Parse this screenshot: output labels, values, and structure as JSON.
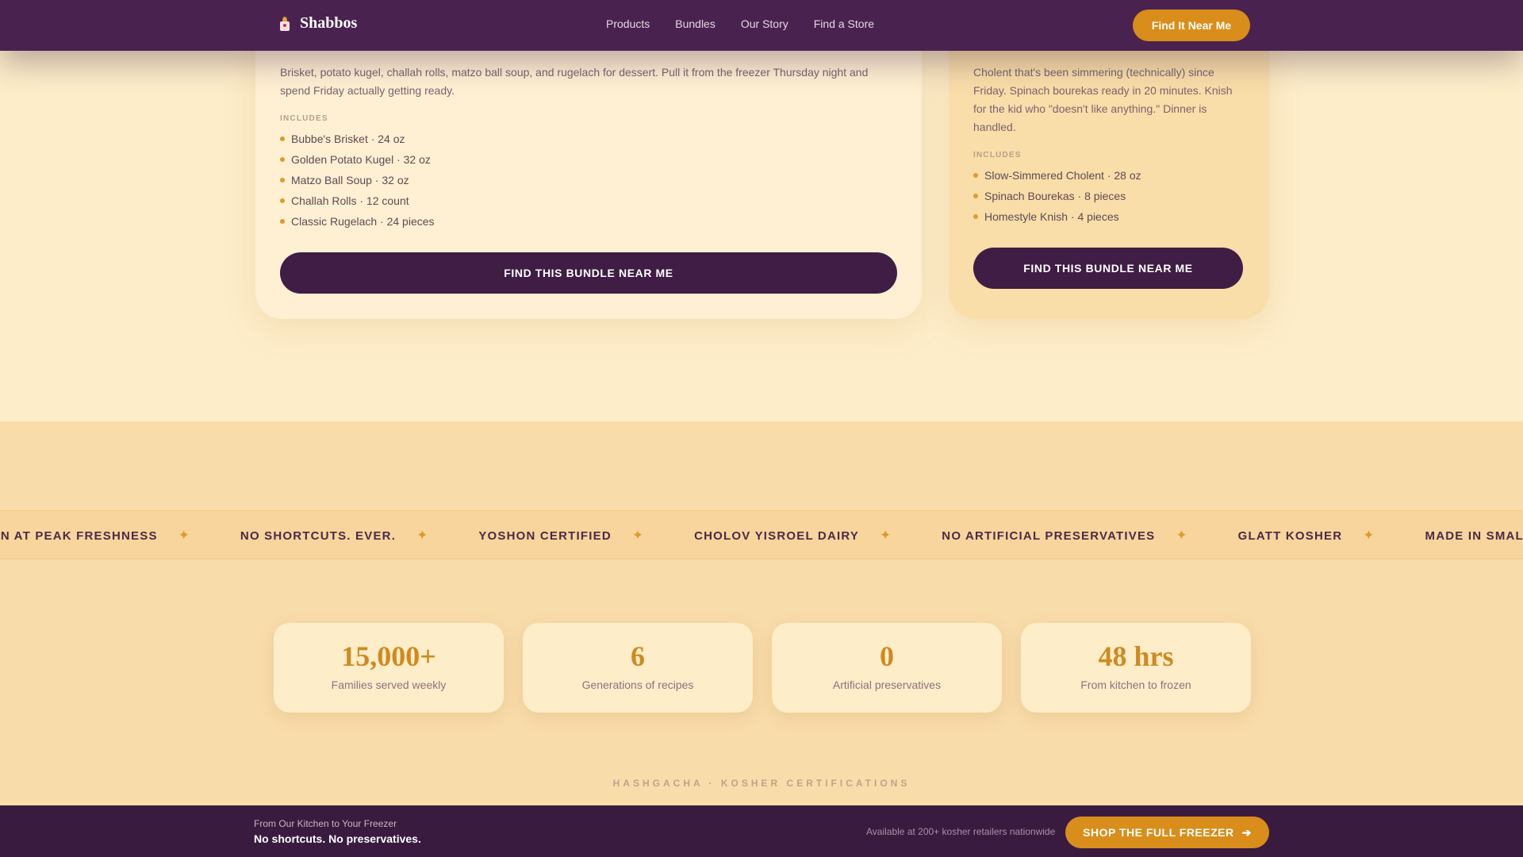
{
  "nav": {
    "brand": "Shabbos",
    "links": [
      "Products",
      "Bundles",
      "Our Story",
      "Find a Store"
    ],
    "cta": "Find It Near Me"
  },
  "bundles": [
    {
      "description": "Brisket, potato kugel, challah rolls, matzo ball soup, and rugelach for dessert. Pull it from the freezer Thursday night and spend Friday actually getting ready.",
      "includes_label": "INCLUDES",
      "items": [
        "Bubbe's Brisket · 24 oz",
        "Golden Potato Kugel · 32 oz",
        "Matzo Ball Soup · 32 oz",
        "Challah Rolls · 12 count",
        "Classic Rugelach · 24 pieces"
      ],
      "button": "FIND THIS BUNDLE NEAR ME"
    },
    {
      "description": "Cholent that's been simmering (technically) since Friday. Spinach bourekas ready in 20 minutes. Knish for the kid who \"doesn't like anything.\" Dinner is handled.",
      "includes_label": "INCLUDES",
      "items": [
        "Slow-Simmered Cholent · 28 oz",
        "Spinach Bourekas · 8 pieces",
        "Homestyle Knish · 4 pieces"
      ],
      "button": "FIND THIS BUNDLE NEAR ME"
    }
  ],
  "marquee": {
    "items": [
      "FROZEN AT PEAK FRESHNESS",
      "NO SHORTCUTS. EVER.",
      "YOSHON CERTIFIED",
      "CHOLOV YISROEL DAIRY",
      "NO ARTIFICIAL PRESERVATIVES",
      "GLATT KOSHER",
      "MADE IN SMALL BATCHES"
    ],
    "separator": "✦"
  },
  "stats": [
    {
      "value": "15,000+",
      "label": "Families served weekly"
    },
    {
      "value": "6",
      "label": "Generations of recipes"
    },
    {
      "value": "0",
      "label": "Artificial preservatives"
    },
    {
      "value": "48 hrs",
      "label": "From kitchen to frozen"
    }
  ],
  "certifications": {
    "label": "HASHGACHA · KOSHER CERTIFICATIONS"
  },
  "bottom_bar": {
    "subtitle": "From Our Kitchen to Your Freezer",
    "title": "No shortcuts. No preservatives.",
    "availability": "Available at 200+ kosher retailers nationwide",
    "cta": "SHOP THE FULL FREEZER",
    "cta_arrow": "➔"
  },
  "colors": {
    "nav_bg": "#4a2250",
    "accent": "#d98d1a",
    "button_dark": "#3f1d45",
    "page_bg": "#fdedc9"
  }
}
